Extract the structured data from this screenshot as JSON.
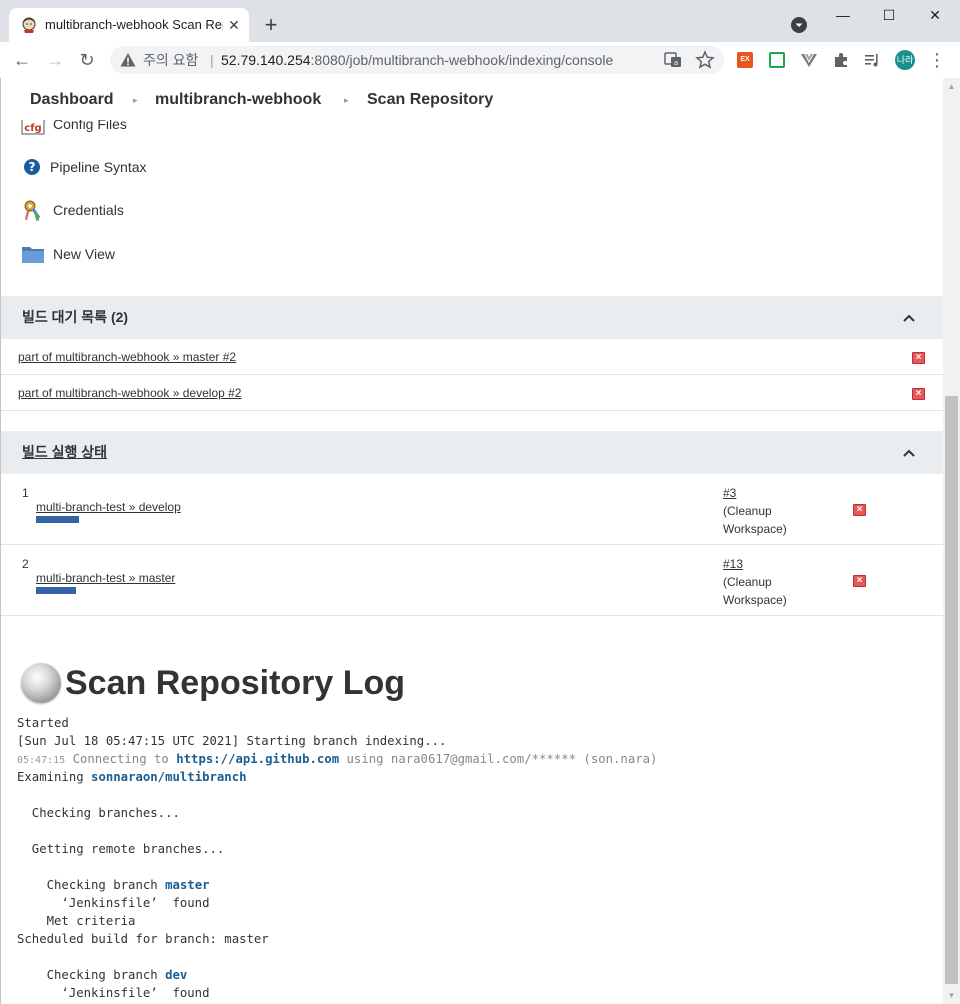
{
  "browser": {
    "tab_title": "multibranch-webhook Scan Rep",
    "security_label": "주의 요함",
    "url_host": "52.79.140.254",
    "url_rest": ":8080/job/multibranch-webhook/indexing/console",
    "profile_label": "나라",
    "minimize": "—",
    "maximize": "☐",
    "close": "✕",
    "new_tab": "+",
    "tab_close": "✕",
    "back": "←",
    "forward": "→",
    "reload": "↻",
    "menu": "⋮",
    "extensions": [
      {
        "name": "ex-extension-icon",
        "color": "#e8541e",
        "label": "EX"
      },
      {
        "name": "screen-extension-icon",
        "color": "#1fa64a",
        "label": ""
      },
      {
        "name": "vue-extension-icon",
        "color": "#7a7a7a",
        "label": ""
      }
    ]
  },
  "breadcrumb": {
    "items": [
      "Dashboard",
      "multibranch-webhook",
      "Scan Repository"
    ]
  },
  "sidebar": {
    "items": [
      {
        "label": "Config Files"
      },
      {
        "label": "Pipeline Syntax"
      },
      {
        "label": "Credentials"
      },
      {
        "label": "New View"
      }
    ]
  },
  "build_queue": {
    "title": "빌드 대기 목록 (2)",
    "items": [
      {
        "label": "part of multibranch-webhook » master #2"
      },
      {
        "label": "part of multibranch-webhook » develop #2"
      }
    ]
  },
  "executors": {
    "title": "빌드 실행 상태",
    "items": [
      {
        "num": "1",
        "job": "multi-branch-test » develop",
        "build": "#3",
        "stage1": "(Cleanup",
        "stage2": "Workspace)",
        "progress": 0.45
      },
      {
        "num": "2",
        "job": "multi-branch-test » master",
        "build": "#13",
        "stage1": "(Cleanup",
        "stage2": "Workspace)",
        "progress": 0.42
      }
    ]
  },
  "log": {
    "title": "Scan Repository Log",
    "lines": [
      {
        "text": "Started"
      },
      {
        "text": "[Sun Jul 18 05:47:15 UTC 2021] Starting branch indexing..."
      },
      {
        "ts": "05:47:15",
        "pre": " Connecting to ",
        "link": "https://api.github.com",
        "post": " using nara0617@gmail.com/****** (son.nara)"
      },
      {
        "pre": "Examining ",
        "hl": "sonnaraon/multibranch"
      },
      {
        "text": ""
      },
      {
        "text": "  Checking branches..."
      },
      {
        "text": ""
      },
      {
        "text": "  Getting remote branches..."
      },
      {
        "text": ""
      },
      {
        "pre": "    Checking branch ",
        "hl": "master"
      },
      {
        "text": "      ‘Jenkinsfile’  found"
      },
      {
        "text": "    Met criteria"
      },
      {
        "text": "Scheduled build for branch: master"
      },
      {
        "text": ""
      },
      {
        "pre": "    Checking branch ",
        "hl": "dev"
      },
      {
        "text": "      ‘Jenkinsfile’  found"
      }
    ]
  }
}
